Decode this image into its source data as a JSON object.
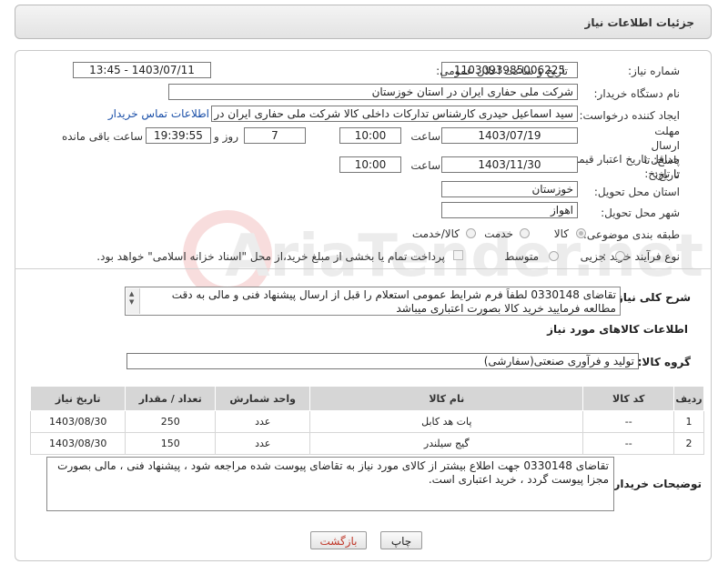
{
  "header": {
    "title": "جزئیات اطلاعات نیاز"
  },
  "form": {
    "need_number_label": "شماره نیاز:",
    "need_number": "1103093985006225",
    "announce_label": "تاریخ و ساعت اعلان عمومی:",
    "announce_value": "1403/07/11 - 13:45",
    "buyer_org_label": "نام دستگاه خریدار:",
    "buyer_org": "شرکت ملی حفاری ایران در استان خوزستان",
    "creator_label": "ایجاد کننده درخواست:",
    "creator": "سید اسماعیل حیدری کارشناس تدارکات داخلی کالا شرکت ملی حفاری ایران در",
    "contact_link": "اطلاعات تماس خریدار",
    "deadline_label": "مهلت ارسال پاسخ: تا تاریخ:",
    "deadline_date": "1403/07/19",
    "time_label": "ساعت",
    "deadline_time": "10:00",
    "days_value": "7",
    "days_label": "روز و",
    "remaining_time": "19:39:55",
    "remaining_label": "ساعت باقی مانده",
    "min_validity_label": "حداقل تاریخ اعتبار قیمت: تا تاریخ:",
    "validity_date": "1403/11/30",
    "validity_time": "10:00",
    "province_label": "استان محل تحویل:",
    "province": "خوزستان",
    "city_label": "شهر محل تحویل:",
    "city": "اهواز",
    "category_label": "طبقه بندی موضوعی:",
    "category_options": [
      "کالا",
      "خدمت",
      "کالا/خدمت"
    ],
    "purchase_type_label": "نوع فرآیند خرید :",
    "purchase_options": [
      "جزیی",
      "متوسط"
    ],
    "payment_note": "پرداخت تمام یا بخشی از مبلغ خرید،از محل \"اسناد خزانه اسلامی\" خواهد بود.",
    "summary_label": "شرح کلی نیاز:",
    "summary": "تقاضای 0330148 لطفاً فرم شرایط عمومی استعلام را قبل از ارسال پیشنهاد فنی و مالی به دقت مطالعه فرمایید خرید کالا بصورت اعتباری میباشد"
  },
  "goods": {
    "section_title": "اطلاعات کالاهای مورد نیاز",
    "group_label": "گروه کالا:",
    "group_value": "تولید و فرآوری صنعتی(سفارشی)",
    "columns": [
      "ردیف",
      "کد کالا",
      "نام کالا",
      "واحد شمارش",
      "تعداد / مقدار",
      "تاریخ نیاز"
    ],
    "rows": [
      {
        "idx": "1",
        "code": "--",
        "name": "پات هد کابل",
        "unit": "عدد",
        "qty": "250",
        "date": "1403/08/30"
      },
      {
        "idx": "2",
        "code": "--",
        "name": "گیج سیلندر",
        "unit": "عدد",
        "qty": "150",
        "date": "1403/08/30"
      }
    ]
  },
  "buyer_notes": {
    "label": "توضیحات خریدار:",
    "text": "تقاضای 0330148 جهت اطلاع بیشتر از کالای مورد نیاز به تقاضای پیوست شده مراجعه شود ، پیشنهاد فنی ، مالی بصورت مجزا پیوست گردد ، خرید اعتباری است."
  },
  "buttons": {
    "print": "چاپ",
    "back": "بازگشت"
  },
  "watermark": {
    "text": "AriaTender.net"
  },
  "colors": {
    "link": "#1a4fa8",
    "back_button_text": "#c0392b",
    "table_header": "#d6d6d6"
  }
}
